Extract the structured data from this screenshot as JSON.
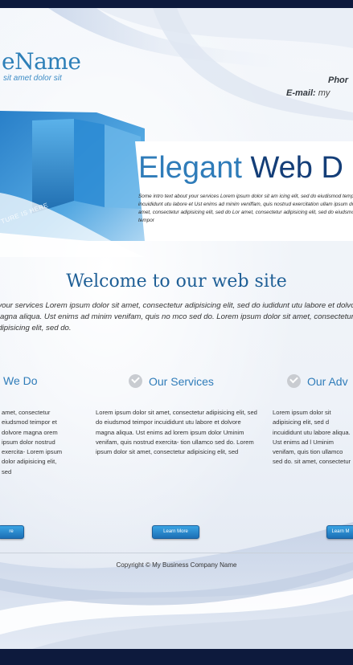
{
  "header": {
    "logo_name": "eName",
    "logo_tagline": "sit amet dolor sit",
    "phone_label": "Phor",
    "email_label": "E-mail:",
    "email_value": "my"
  },
  "hero": {
    "picture_label": "TURE IS HERE",
    "title_part1": "Elegant",
    "title_part2": "Web D",
    "description": "Some intro text about your services Lorem ipsum dolor sit am icing elit, sed do eiudismod tempor incuididunt utu labore et Ust enims ad minim veniffam, quis nostrud exercitation ullam ipsum dolor sit amet, consectetur adipisicing elit, sed do Lor amet, consectetur adipisicing elit, sed do eiudsmod tempor"
  },
  "welcome": {
    "title": "Welcome to our web site",
    "intro": "t your services Lorem ipsum dolor sit amet, consectetur adipisicing elit, sed do iudidunt utu labore et dolvore magna aliqua. Ust enims ad minim venifam, quis no mco  sed do.  Lorem ipsum dolor sit amet, consectetur adipisicing elit, sed do."
  },
  "columns": [
    {
      "heading": "We Do",
      "text": "amet, consectetur eiudsmod teimpor et dolvore magna orem ipsum dolor nostrud exercita- Lorem ipsum dolor adipisicing elit, sed",
      "button": "re"
    },
    {
      "heading": "Our Services",
      "text": "Lorem ipsum dolor sit amet, consectetur adipisicing elit, sed do eiudsmod teimpor incuididunt utu labore et dolvore magna aliqua. Ust enims ad lorem ipsum dolor Uminim venifam, quis nostrud exercita- tion ullamco  sed do.  Lorem ipsum dolor sit amet, consectetur adipisicing elit, sed",
      "button": "Learn More"
    },
    {
      "heading": "Our Adv",
      "text": "Lorem ipsum dolor sit adipisicing elit, sed d incuididunt utu labore aliqua. Ust enims ad l Uminim venifam, quis tion ullamco  sed do. sit amet, consectetur",
      "button": "Learn M"
    }
  ],
  "footer": {
    "copyright": "Copyright © My Business Company Name"
  },
  "colors": {
    "accent": "#2f7cb9",
    "dark_blue": "#143e78",
    "button": "#1c6fb5",
    "frame": "#0d1a3d"
  }
}
